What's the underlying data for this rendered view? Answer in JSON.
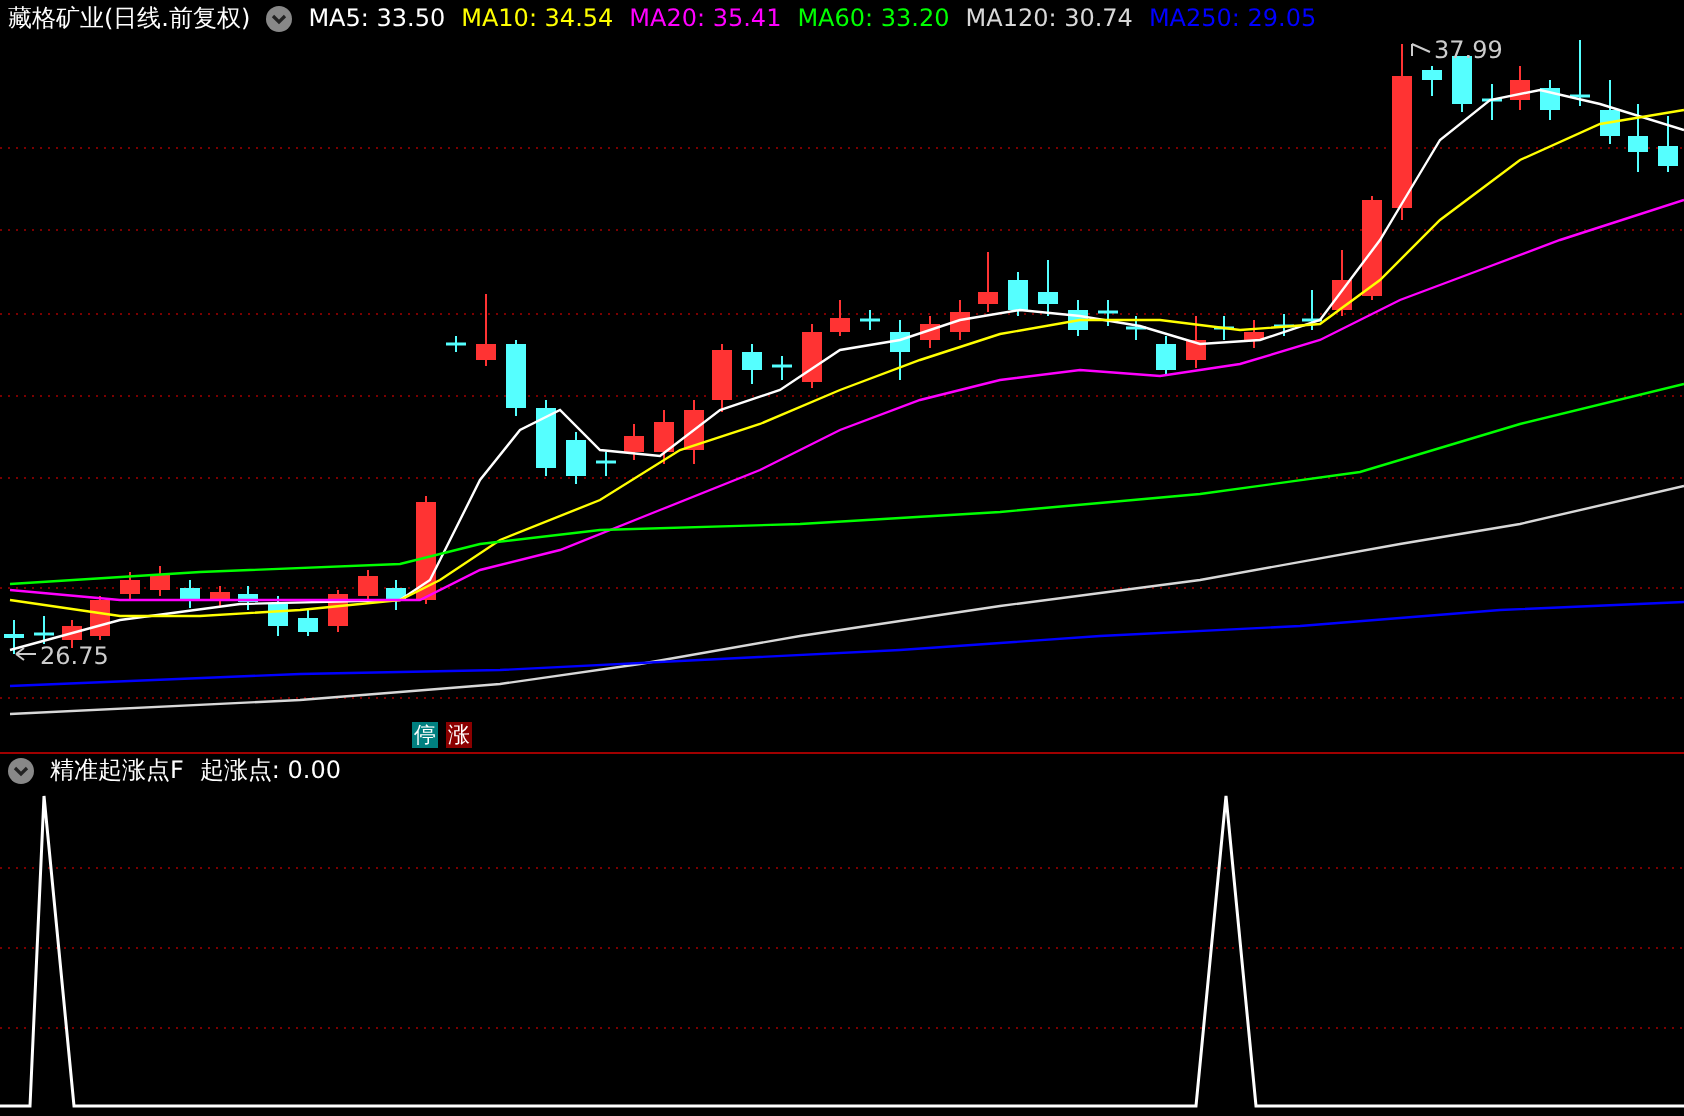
{
  "header": {
    "title": "藏格矿业(日线.前复权)",
    "indicators": [
      {
        "label": "MA5: 33.50",
        "color": "#ffffff"
      },
      {
        "label": "MA10: 34.54",
        "color": "#ffff00"
      },
      {
        "label": "MA20: 35.41",
        "color": "#ff00ff"
      },
      {
        "label": "MA60: 33.20",
        "color": "#00ff00"
      },
      {
        "label": "MA120: 30.74",
        "color": "#d8d8d8"
      },
      {
        "label": "MA250: 29.05",
        "color": "#0000ff"
      }
    ]
  },
  "price_chart": {
    "low_label": "26.75",
    "high_label": "37.99",
    "markers": [
      {
        "text": "停",
        "color": "#008080"
      },
      {
        "text": "涨",
        "color": "#8b0000"
      }
    ]
  },
  "indicator_panel": {
    "title": "精准起涨点F",
    "reading": "起涨点: 0.00"
  }
}
